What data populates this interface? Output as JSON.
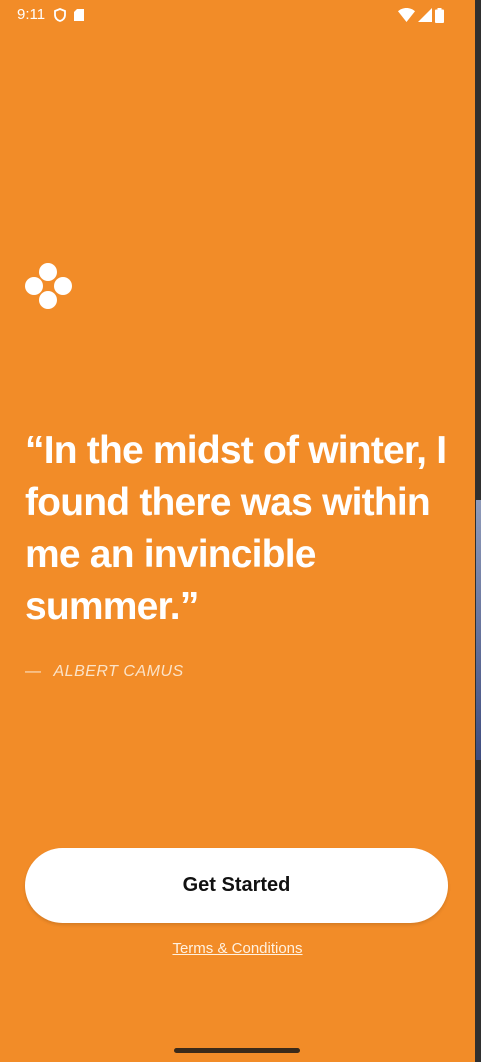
{
  "status_bar": {
    "time": "9:11",
    "left_icons": [
      "shield-icon",
      "sd-card-icon"
    ],
    "right_icons": [
      "wifi-icon",
      "cellular-signal-icon",
      "battery-icon"
    ]
  },
  "logo": {
    "icon": "four-dots-logo-icon"
  },
  "quote": {
    "text": "“In the midst of winter, I found there was within me an invincible summer.”",
    "author_dash": "—",
    "author": "ALBERT CAMUS"
  },
  "actions": {
    "primary_label": "Get Started",
    "terms_label": "Terms & Conditions"
  },
  "colors": {
    "background": "#F28C28",
    "button_background": "#FFFFFF",
    "button_text": "#111111",
    "quote_text": "#FFFFFF",
    "author_text": "#FBE3C8"
  }
}
